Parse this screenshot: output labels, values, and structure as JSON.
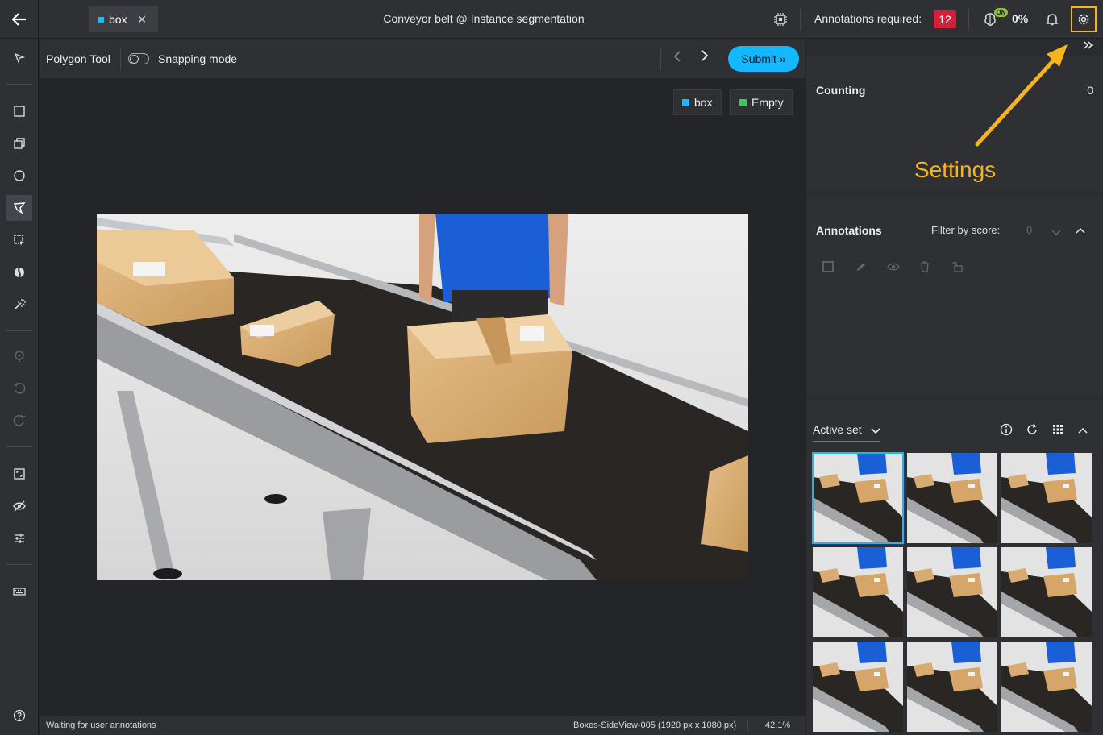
{
  "topbar": {
    "tab_label": "box",
    "tab_color": "#1fb5ff",
    "title": "Conveyor belt @ Instance segmentation",
    "annotations_required_label": "Annotations required:",
    "annotations_required_count": "12",
    "ai_status": "ON",
    "ai_percent": "0%"
  },
  "toolbar": {
    "tool_name": "Polygon Tool",
    "snapping_label": "Snapping mode",
    "snapping_on": false,
    "submit_label": "Submit »"
  },
  "left_tools": [
    "pointer-icon",
    "rectangle-icon",
    "rotated-rectangle-icon",
    "circle-icon",
    "polygon-icon",
    "detection-assistant-icon",
    "segment-anything-icon",
    "magic-wand-icon",
    "edit-point-icon",
    "undo-icon",
    "redo-icon",
    "fit-image-icon",
    "hide-annotations-icon",
    "adjust-icon",
    "keyboard-icon",
    "help-icon"
  ],
  "labels": [
    {
      "name": "box",
      "color": "#1fb5ff"
    },
    {
      "name": "Empty",
      "color": "#3cc85a"
    }
  ],
  "status": {
    "message": "Waiting for user annotations",
    "file_info": "Boxes-SideView-005 (1920 px x 1080 px)",
    "zoom": "42.1%"
  },
  "right_panel": {
    "counting_label": "Counting",
    "counting_value": "0",
    "callout": "Settings",
    "annotations_label": "Annotations",
    "filter_label": "Filter by score:",
    "filter_value": "0",
    "dataset_label": "Active set"
  }
}
